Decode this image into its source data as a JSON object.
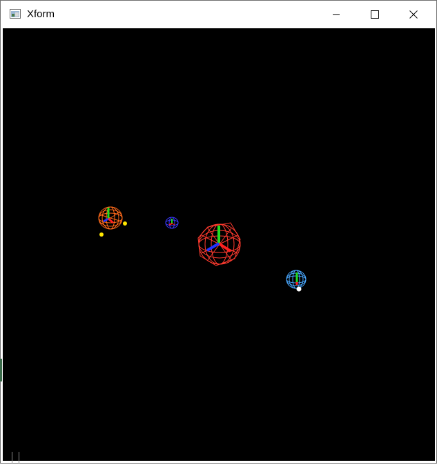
{
  "window": {
    "title": "Xform",
    "app_icon": "window-app-icon",
    "controls": {
      "minimize": "minimize-icon",
      "maximize": "maximize-icon",
      "close": "close-icon"
    }
  },
  "scene": {
    "background": "#000000",
    "objects": [
      {
        "name": "orange-wireframe-sphere",
        "color": "#ff6a1a",
        "axes": true
      },
      {
        "name": "small-blue-wireframe-sphere",
        "color": "#3a3aff",
        "axes": true
      },
      {
        "name": "red-wireframe-sphere",
        "color": "#ff3b2f",
        "axes": true
      },
      {
        "name": "light-blue-wireframe-sphere",
        "color": "#49a8ff",
        "axes": true
      }
    ],
    "markers": [
      {
        "name": "yellow-marker",
        "color": "#ffe600"
      },
      {
        "name": "yellow-marker",
        "color": "#ffe600"
      },
      {
        "name": "white-marker",
        "color": "#ffffff"
      }
    ],
    "axis_colors": {
      "x": "#ff2020",
      "y": "#22dd22",
      "z": "#2233ff"
    }
  }
}
